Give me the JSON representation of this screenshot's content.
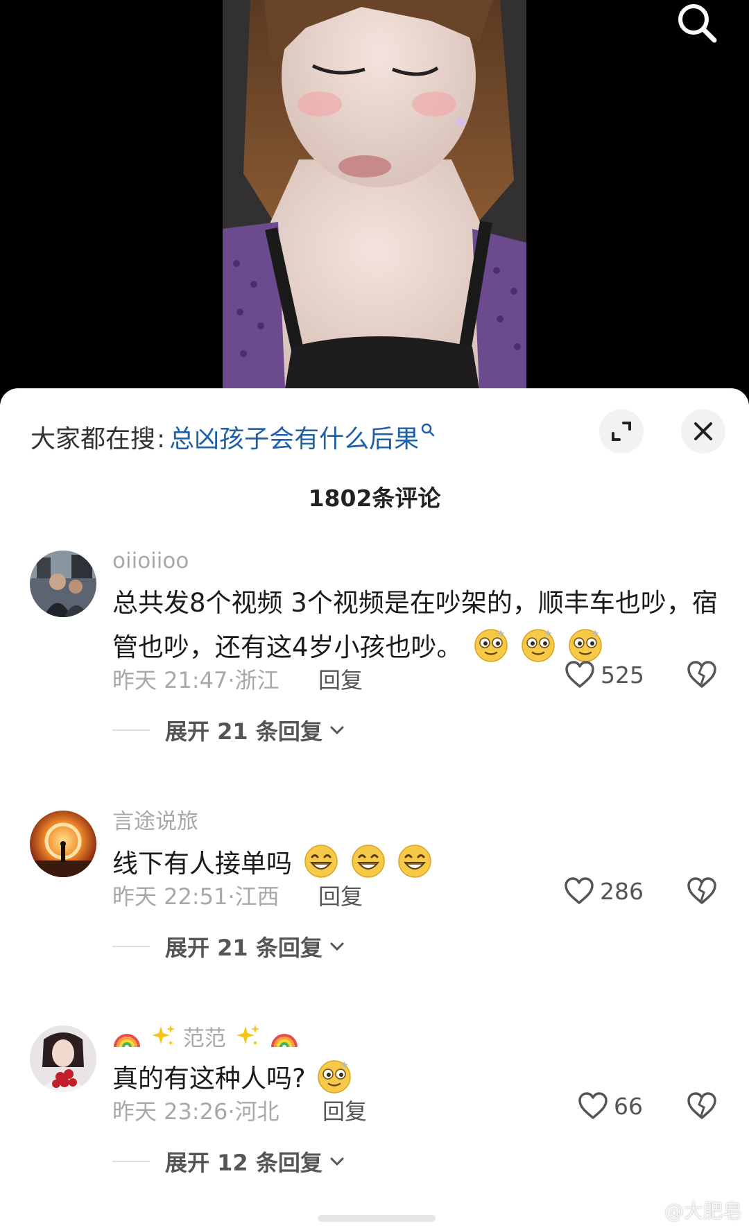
{
  "header": {
    "trend_prefix": "大家都在搜",
    "trend_separator": ":",
    "trend_term": "总凶孩子会有什么后果",
    "expand_icon": "expand-icon",
    "close_icon": "close-icon",
    "comment_count": "1802条评论"
  },
  "comments": [
    {
      "username": "oiioiioo",
      "text": "总共发8个视频 3个视频是在吵架的，顺丰车也吵，宿管也吵，还有这4岁小孩也吵。",
      "emojis": [
        "dizzy-face-emoji",
        "dizzy-face-emoji",
        "dizzy-face-emoji"
      ],
      "time": "昨天 21:47",
      "location": "浙江",
      "reply_label": "回复",
      "likes": "525",
      "expand_label": "展开 21 条回复"
    },
    {
      "username": "言途说旅",
      "text": "线下有人接单吗",
      "emojis": [
        "grinning-face-emoji",
        "grinning-face-emoji",
        "grinning-face-emoji"
      ],
      "time": "昨天 22:51",
      "location": "江西",
      "reply_label": "回复",
      "likes": "286",
      "expand_label": "展开 21 条回复"
    },
    {
      "username": "范范",
      "username_decor": [
        "rainbow-emoji",
        "sparkles-emoji",
        "sparkles-emoji",
        "rainbow-emoji"
      ],
      "text": "真的有这种人吗?",
      "emojis": [
        "dizzy-face-emoji"
      ],
      "time": "昨天 23:26",
      "location": "河北",
      "reply_label": "回复",
      "likes": "66",
      "expand_label": "展开 12 条回复"
    }
  ],
  "watermark": "@大肥皂",
  "colors": {
    "link": "#1d5fa8",
    "muted": "#a8a8a8",
    "text": "#1a1a1a"
  }
}
